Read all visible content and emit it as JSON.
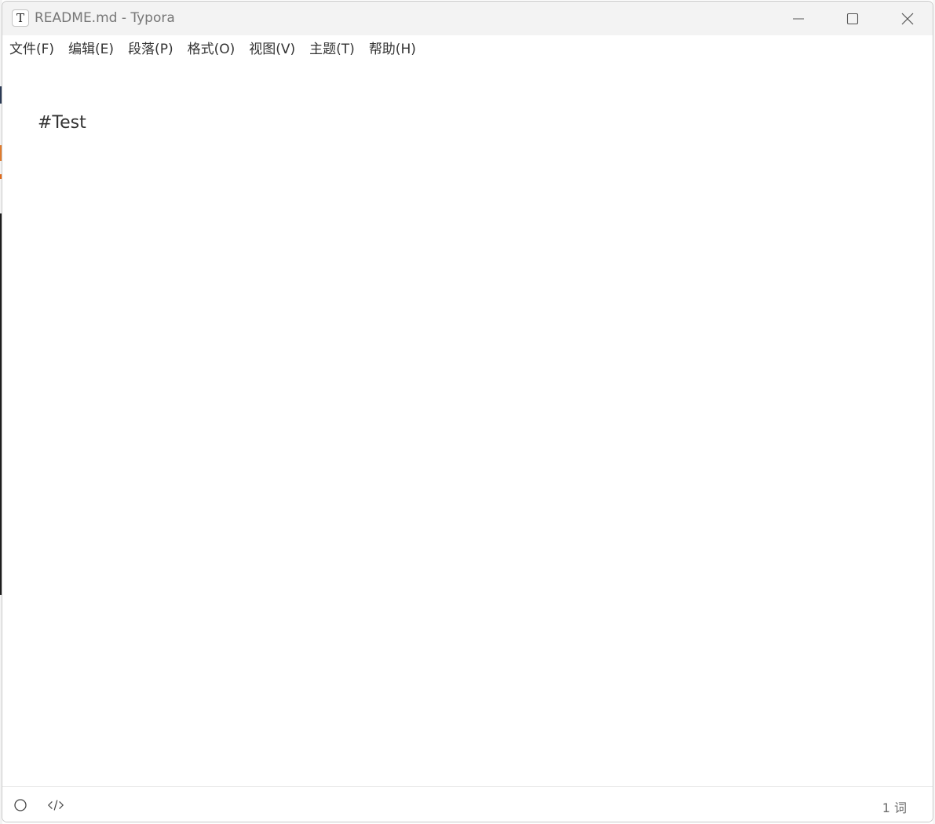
{
  "window": {
    "app_icon_letter": "T",
    "title": "README.md - Typora"
  },
  "window_controls": {
    "minimize_icon": "minimize-icon",
    "maximize_icon": "maximize-icon",
    "close_icon": "close-icon"
  },
  "menubar": {
    "items": [
      {
        "label": "文件(F)"
      },
      {
        "label": "编辑(E)"
      },
      {
        "label": "段落(P)"
      },
      {
        "label": "格式(O)"
      },
      {
        "label": "视图(V)"
      },
      {
        "label": "主题(T)"
      },
      {
        "label": "帮助(H)"
      }
    ]
  },
  "editor": {
    "content": "#Test"
  },
  "statusbar": {
    "outline_icon": "circle-icon",
    "source_icon": "code-icon",
    "word_count": "1 词"
  },
  "colors": {
    "titlebar_bg": "#f3f3f3",
    "text": "#333333",
    "title_text": "#777777",
    "status_text": "#6b6b6b"
  }
}
